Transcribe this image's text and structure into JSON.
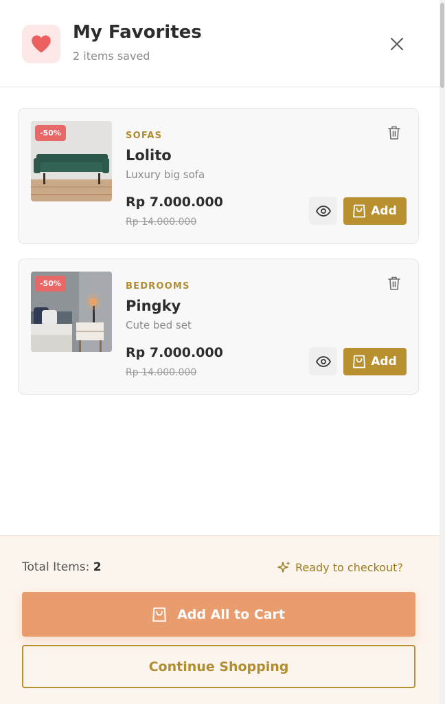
{
  "header": {
    "title": "My Favorites",
    "subtitle": "2 items saved"
  },
  "items": [
    {
      "discount": "-50%",
      "category": "SOFAS",
      "name": "Lolito",
      "description": "Luxury big sofa",
      "price": "Rp 7.000.000",
      "old_price": "Rp 14.000.000",
      "add_label": "Add"
    },
    {
      "discount": "-50%",
      "category": "BEDROOMS",
      "name": "Pingky",
      "description": "Cute bed set",
      "price": "Rp 7.000.000",
      "old_price": "Rp 14.000.000",
      "add_label": "Add"
    }
  ],
  "footer": {
    "total_label": "Total Items:",
    "total_count": "2",
    "ready_text": "Ready to checkout?",
    "add_all_label": "Add All to Cart",
    "continue_label": "Continue Shopping"
  },
  "colors": {
    "accent_gold": "#b9902f",
    "accent_orange": "#e99d6f",
    "heart_red": "#ec5f5f",
    "badge_red": "#e86767"
  },
  "icons": [
    "heart-icon",
    "close-icon",
    "trash-icon",
    "eye-icon",
    "shopping-bag-icon",
    "sparkle-icon"
  ]
}
